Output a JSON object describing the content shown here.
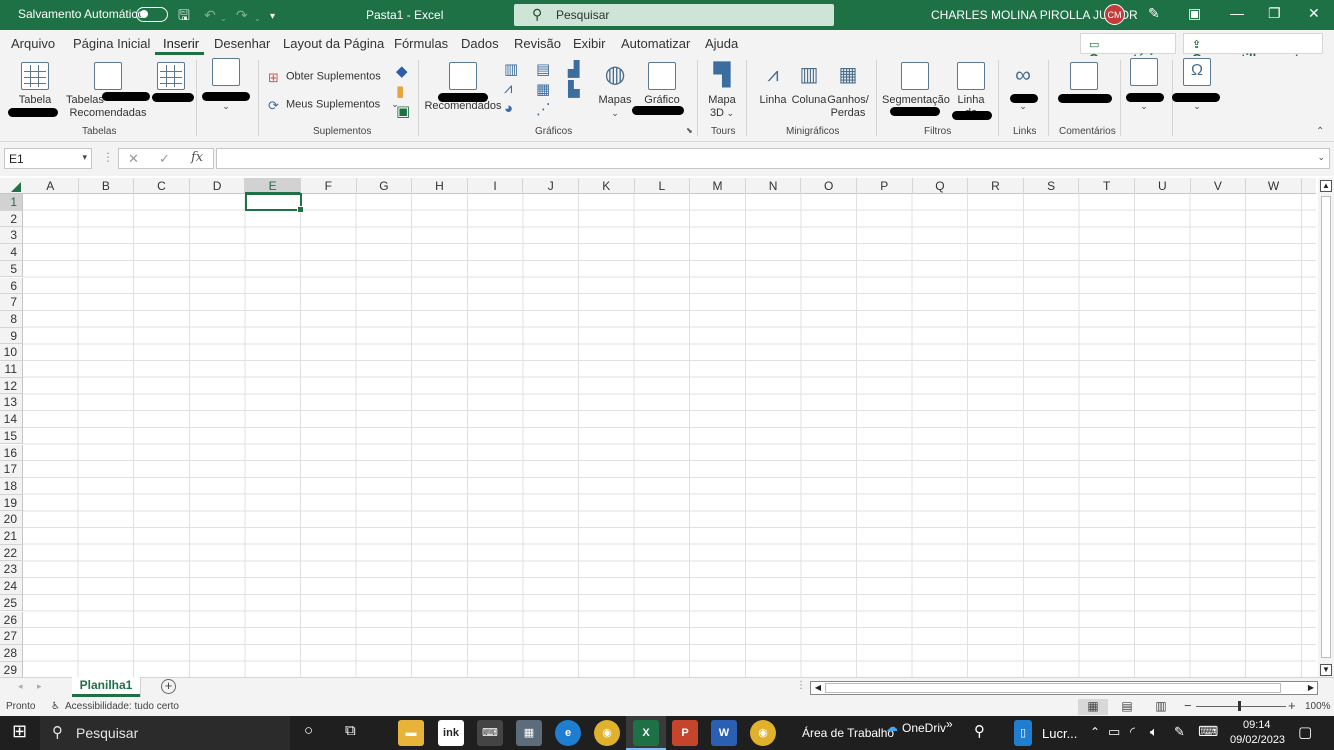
{
  "titlebar": {
    "autosave_label": "Salvamento Automático",
    "doc_title": "Pasta1  -  Excel",
    "search_placeholder": "Pesquisar",
    "user_name": "CHARLES MOLINA PIROLLA JUNIOR",
    "avatar_initials": "CM"
  },
  "menu": {
    "tabs": [
      "Arquivo",
      "Página Inicial",
      "Inserir",
      "Desenhar",
      "Layout da Página",
      "Fórmulas",
      "Dados",
      "Revisão",
      "Exibir",
      "Automatizar",
      "Ajuda"
    ],
    "active_tab": "Inserir",
    "comments_button": "Comentários",
    "share_button": "Compartilhamento"
  },
  "ribbon": {
    "tabela": "Tabela",
    "tabelas_line1": "Tabelas",
    "tabelas_line2": "Recomendadas",
    "group_tabelas": "Tabelas",
    "obter_suplementos": "Obter Suplementos",
    "meus_suplementos": "Meus Suplementos",
    "group_suplementos": "Suplementos",
    "recomendados": "Recomendados",
    "mapas": "Mapas",
    "grafico": "Gráfico",
    "group_graficos": "Gráficos",
    "mapa_line1": "Mapa",
    "mapa_line2": "3D",
    "group_tours": "Tours",
    "linha": "Linha",
    "coluna": "Coluna",
    "ganhos_line1": "Ganhos/",
    "ganhos_line2": "Perdas",
    "group_minigraficos": "Minigráficos",
    "segmentacao": "Segmentação",
    "linha_do": "Linha do",
    "group_filtros": "Filtros",
    "group_links": "Links",
    "group_comentarios": "Comentários"
  },
  "formula_bar": {
    "name_box": "E1",
    "fx": "fx",
    "formula": ""
  },
  "grid": {
    "columns": [
      "A",
      "B",
      "C",
      "D",
      "E",
      "F",
      "G",
      "H",
      "I",
      "J",
      "K",
      "L",
      "M",
      "N",
      "O",
      "P",
      "Q",
      "R",
      "S",
      "T",
      "U",
      "V",
      "W"
    ],
    "rows": [
      "1",
      "2",
      "3",
      "4",
      "5",
      "6",
      "7",
      "8",
      "9",
      "10",
      "11",
      "12",
      "13",
      "14",
      "15",
      "16",
      "17",
      "18",
      "19",
      "20",
      "21",
      "22",
      "23",
      "24",
      "25",
      "26",
      "27",
      "28",
      "29"
    ],
    "selected_column": "E",
    "selected_row": "1"
  },
  "sheets": {
    "tabs": [
      "Planilha1"
    ]
  },
  "status": {
    "ready": "Pronto",
    "accessibility": "Acessibilidade: tudo certo",
    "zoom": "100%"
  },
  "taskbar": {
    "search_placeholder": "Pesquisar",
    "desktop_label": "Área de Trabalho",
    "onedrive_label": "OneDriv",
    "app_label": "Lucr...",
    "time": "09:14",
    "date": "09/02/2023"
  },
  "colors": {
    "excel_green": "#1e7145",
    "avatar_red": "#c33b3b"
  }
}
